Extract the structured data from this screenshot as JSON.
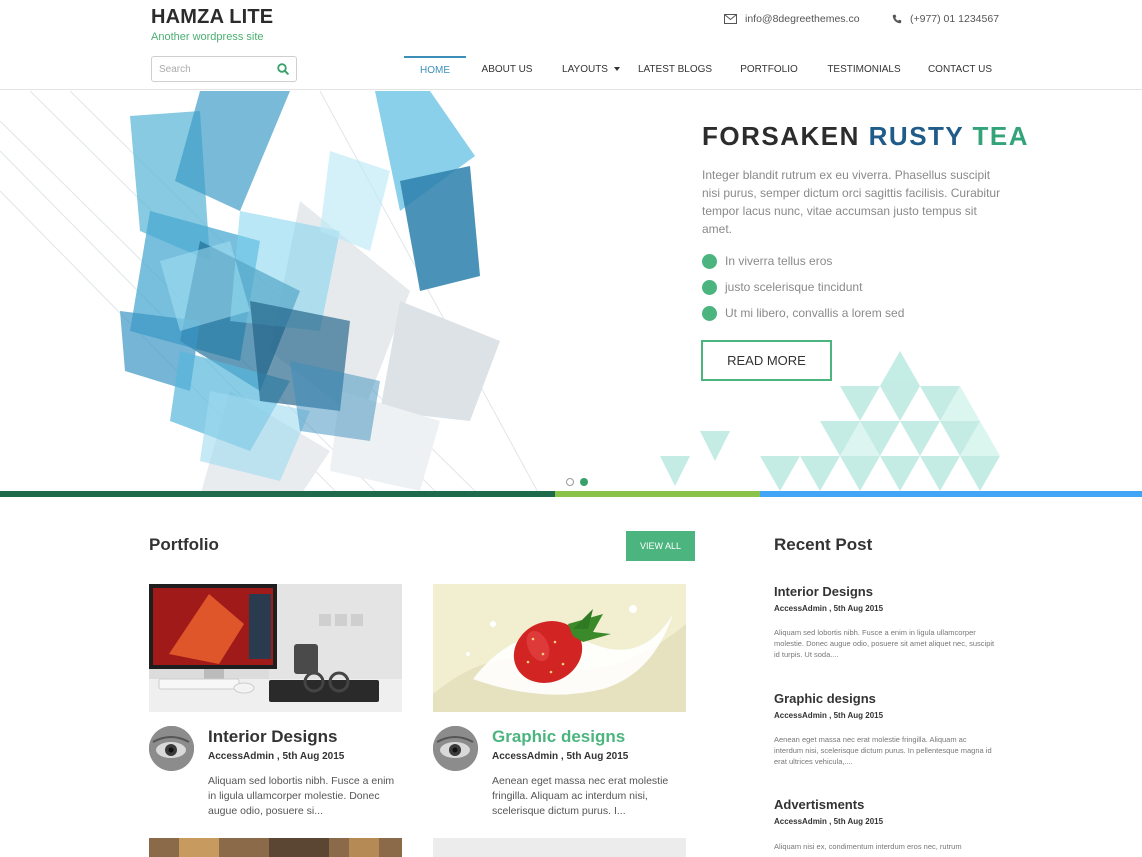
{
  "site": {
    "title": "HAMZA LITE",
    "tagline": "Another wordpress site"
  },
  "contact": {
    "email": "info@8degreethemes.co",
    "email_icon": "envelope-icon",
    "phone": "(+977) 01 1234567",
    "phone_icon": "phone-icon"
  },
  "search": {
    "placeholder": "Search",
    "value": "",
    "icon": "search-icon"
  },
  "nav": {
    "items": [
      {
        "label": "HOME",
        "active": true
      },
      {
        "label": "ABOUT US"
      },
      {
        "label": "LAYOUTS",
        "has_dropdown": true
      },
      {
        "label": "LATEST BLOGS"
      },
      {
        "label": "PORTFOLIO"
      },
      {
        "label": "TESTIMONIALS"
      },
      {
        "label": "CONTACT US"
      }
    ]
  },
  "hero": {
    "title_word1": "FORSAKEN",
    "title_word2": "RUSTY",
    "title_word3": "TEA",
    "text": "Integer blandit rutrum ex eu viverra. Phasellus suscipit nisi purus, semper dictum orci sagittis facilisis. Curabitur tempor lacus nunc, vitae accumsan justo tempus sit amet.",
    "bullets": [
      "In viverra tellus eros",
      "justo scelerisque tincidunt",
      "Ut mi libero, convallis a lorem sed"
    ],
    "button": "READ MORE",
    "slides": 2,
    "active_slide": 2
  },
  "colors": {
    "accent_green": "#4cb47f",
    "nav_active": "#3e8fb8",
    "title_blue": "#1f5c8a",
    "title_green": "#33a37a",
    "bar": [
      "#1e6a4a",
      "#8bc34a",
      "#42a5f5"
    ]
  },
  "portfolio": {
    "heading": "Portfolio",
    "view_all": "VIEW ALL",
    "cards": [
      {
        "title": "Interior Designs",
        "meta": "AccessAdmin , 5th Aug 2015",
        "excerpt": "Aliquam sed lobortis nibh. Fusce a enim in ligula ullamcorper molestie. Donec augue odio, posuere si...",
        "image": "desk-computer-image"
      },
      {
        "title": "Graphic designs",
        "meta": "AccessAdmin , 5th Aug 2015",
        "excerpt": "Aenean eget massa nec erat molestie fringilla. Aliquam ac interdum nisi, scelerisque dictum purus. I...",
        "image": "strawberry-splash-image"
      }
    ]
  },
  "recent": {
    "heading": "Recent Post",
    "posts": [
      {
        "title": "Interior Designs",
        "meta": "AccessAdmin , 5th Aug 2015",
        "text": "Aliquam sed lobortis nibh. Fusce a enim in ligula ullamcorper molestie. Donec augue odio, posuere sit amet aliquet nec, suscipit id turpis. Ut soda...."
      },
      {
        "title": "Graphic designs",
        "meta": "AccessAdmin , 5th Aug 2015",
        "text": "Aenean eget massa nec erat molestie fringilla. Aliquam ac interdum nisi, scelerisque dictum purus. In pellentesque magna id erat ultrices vehicula,...."
      },
      {
        "title": "Advertisments",
        "meta": "AccessAdmin , 5th Aug 2015",
        "text": "Aliquam nisi ex, condimentum interdum eros nec, rutrum"
      }
    ]
  }
}
